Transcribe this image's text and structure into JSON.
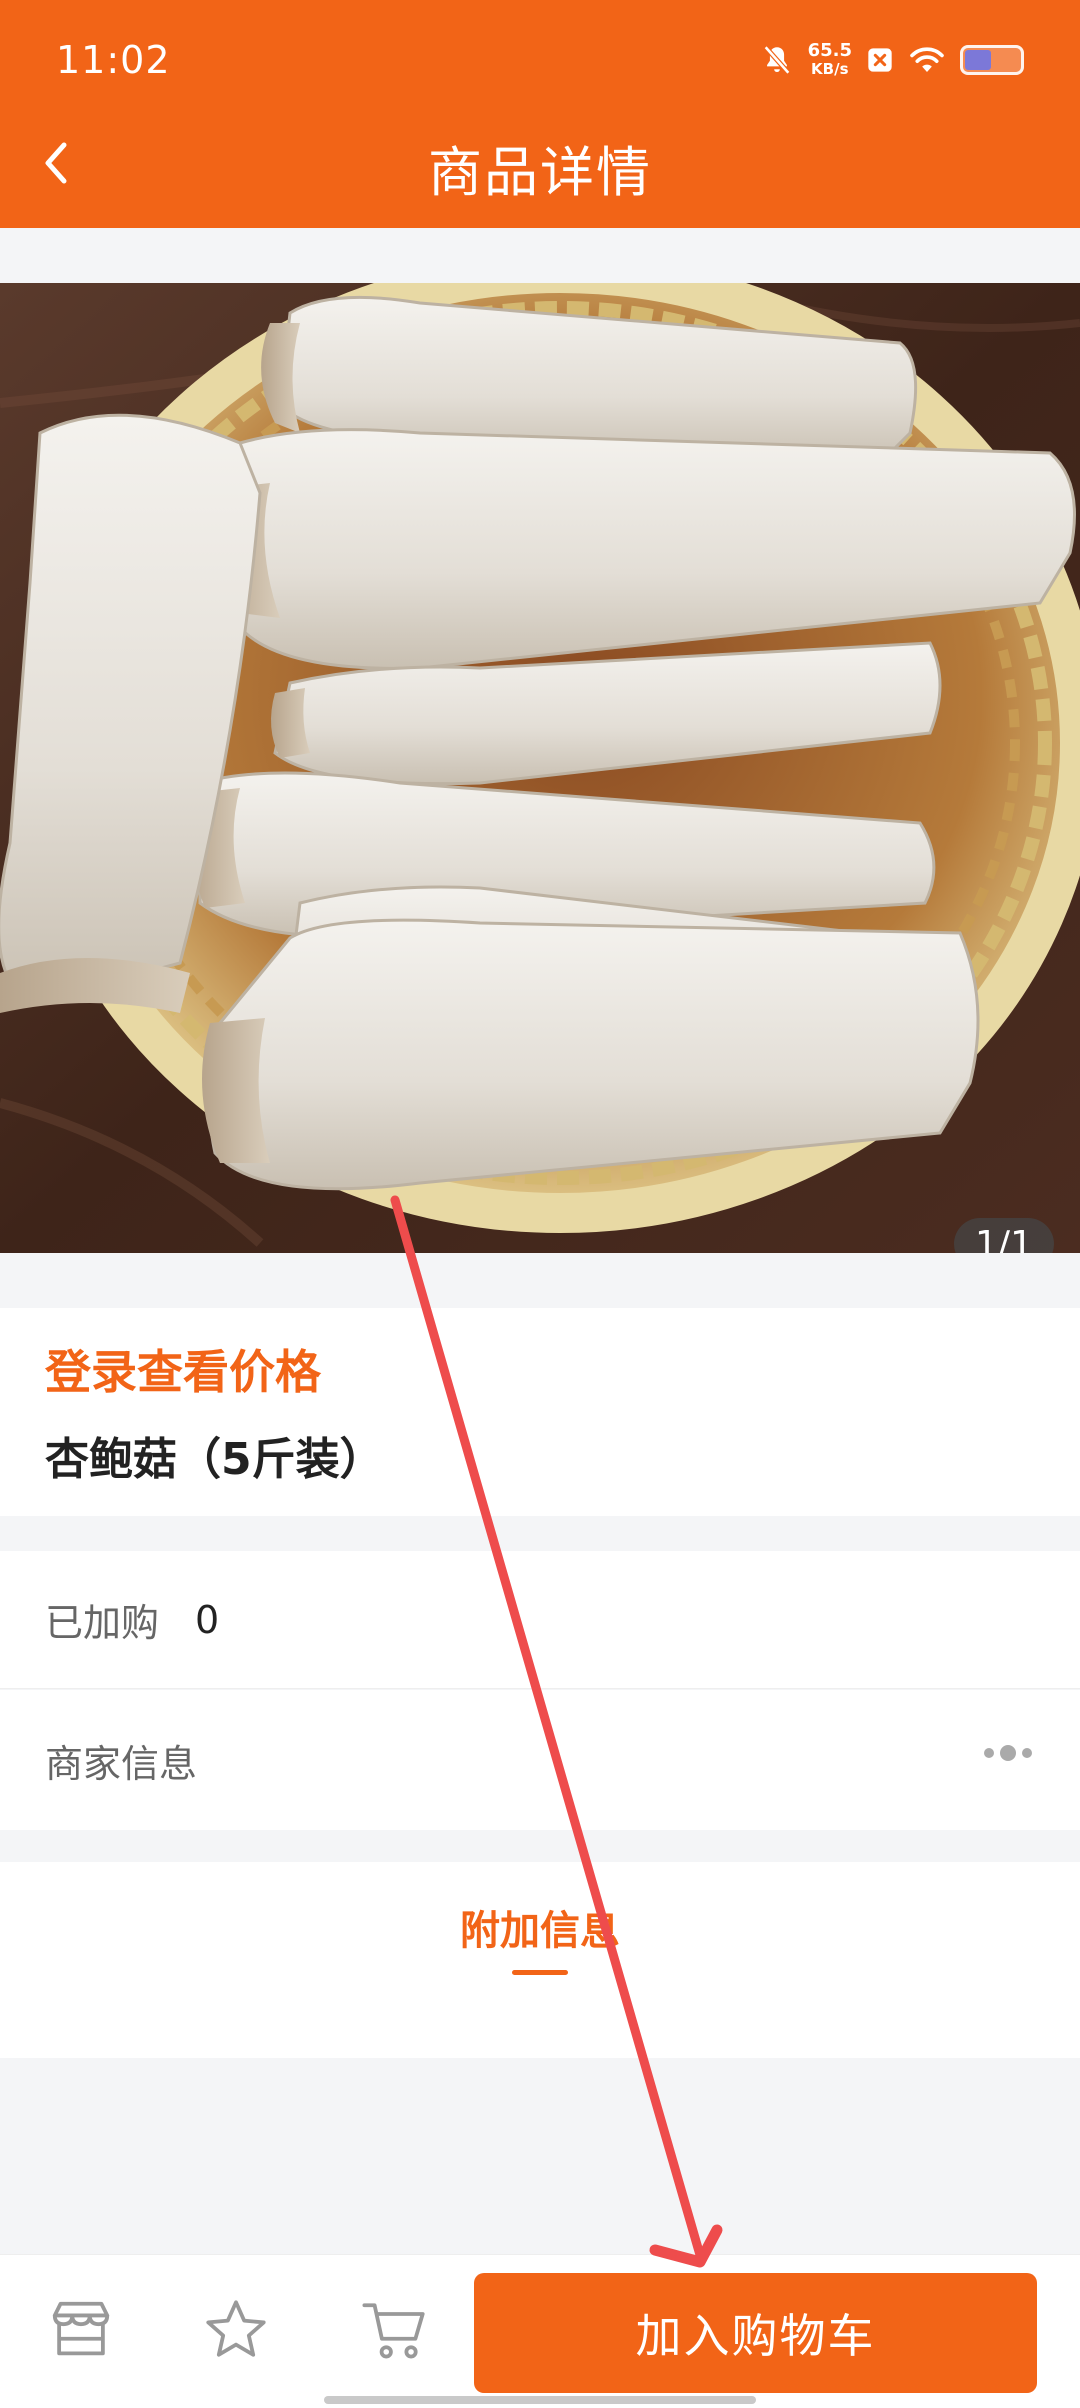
{
  "status_bar": {
    "time": "11:02",
    "net_speed": "65.5",
    "net_unit": "KB/s"
  },
  "header": {
    "title": "商品详情"
  },
  "gallery": {
    "counter": "1/1"
  },
  "product": {
    "price_prompt": "登录查看价格",
    "name": "杏鲍菇（5斤装）"
  },
  "rows": {
    "added_label": "已加购",
    "added_value": "0",
    "merchant_label": "商家信息"
  },
  "extra": {
    "tab_label": "附加信息"
  },
  "bottom_bar": {
    "add_to_cart": "加入购物车"
  },
  "colors": {
    "brand": "#f26417",
    "annotation_arrow": "#ee4c4c"
  },
  "icons": [
    "back-icon",
    "mute-bell-icon",
    "close-box-icon",
    "wifi-icon",
    "battery-icon",
    "more-icon",
    "store-icon",
    "star-icon",
    "cart-icon"
  ]
}
